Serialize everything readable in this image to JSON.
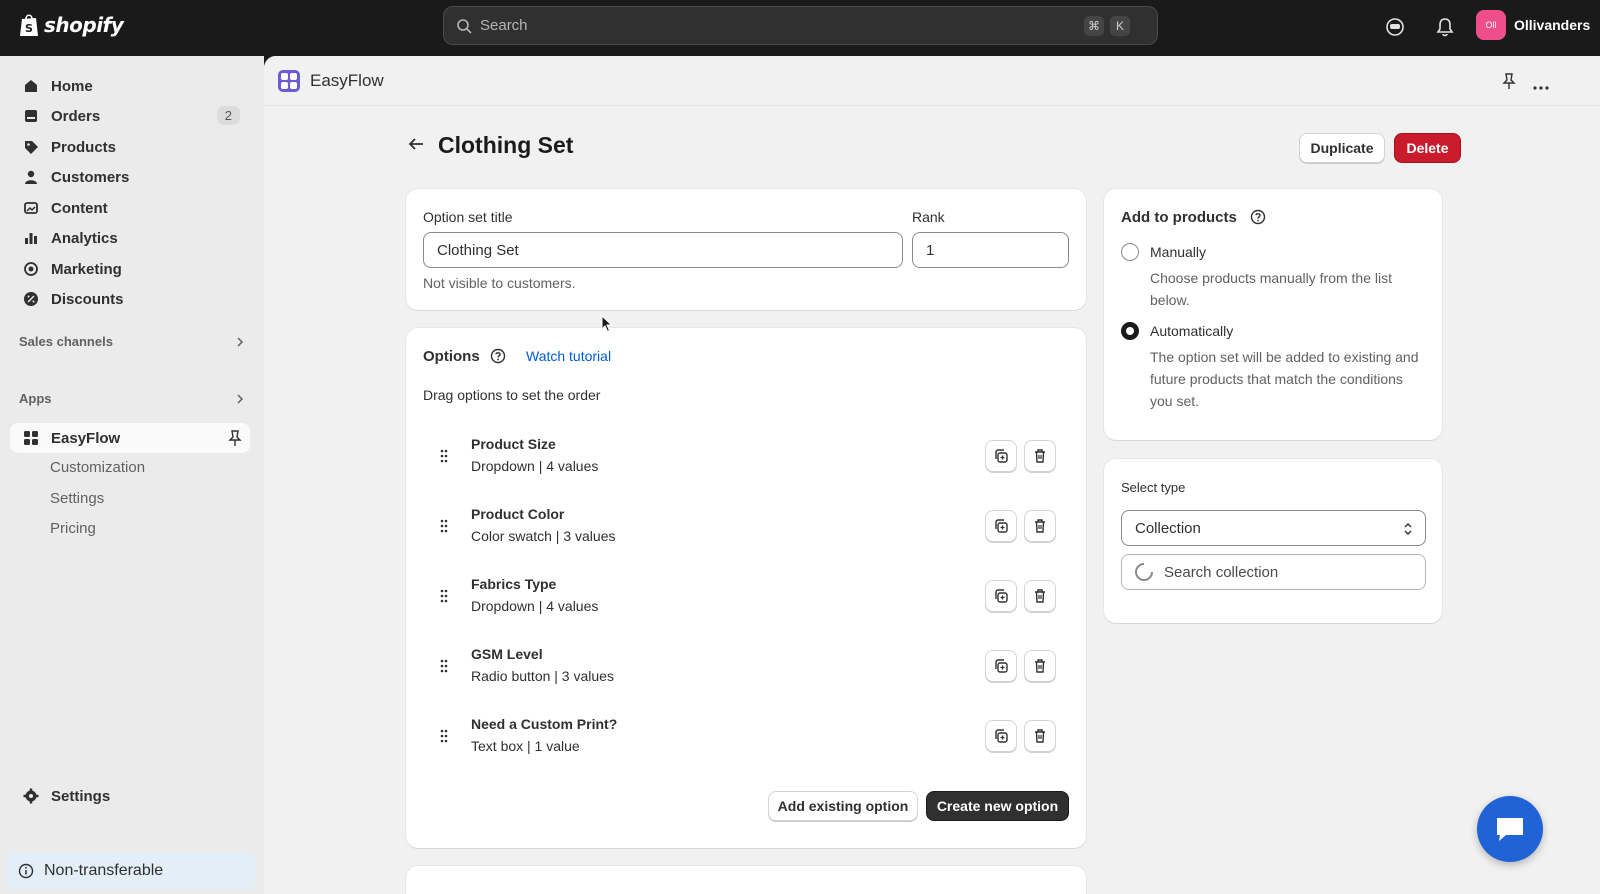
{
  "topbar": {
    "brand": "shopify",
    "search_placeholder": "Search",
    "shortcut_key1": "⌘",
    "shortcut_key2": "K",
    "store_initials": "Oll",
    "store_name": "Ollivanders"
  },
  "sidebar": {
    "items": [
      {
        "label": "Home",
        "icon": "home-icon"
      },
      {
        "label": "Orders",
        "icon": "orders-icon",
        "badge": "2"
      },
      {
        "label": "Products",
        "icon": "tag-icon"
      },
      {
        "label": "Customers",
        "icon": "person-icon"
      },
      {
        "label": "Content",
        "icon": "image-icon"
      },
      {
        "label": "Analytics",
        "icon": "bar-chart-icon"
      },
      {
        "label": "Marketing",
        "icon": "target-icon"
      },
      {
        "label": "Discounts",
        "icon": "discount-icon"
      }
    ],
    "sales_channels": "Sales channels",
    "apps": "Apps",
    "app_name": "EasyFlow",
    "app_sub": [
      "Customization",
      "Settings",
      "Pricing"
    ],
    "settings": "Settings",
    "non_transferable": "Non-transferable"
  },
  "app_header": {
    "title": "EasyFlow"
  },
  "page": {
    "title": "Clothing Set",
    "duplicate": "Duplicate",
    "delete": "Delete"
  },
  "title_card": {
    "title_label": "Option set title",
    "title_value": "Clothing Set",
    "rank_label": "Rank",
    "rank_value": "1",
    "hint": "Not visible to customers."
  },
  "options_card": {
    "heading": "Options",
    "tutorial_link": "Watch tutorial",
    "subtext": "Drag options to set the order",
    "options": [
      {
        "name": "Product Size",
        "meta": "Dropdown | 4 values"
      },
      {
        "name": "Product Color",
        "meta": "Color swatch | 3 values"
      },
      {
        "name": "Fabrics Type",
        "meta": "Dropdown | 4 values"
      },
      {
        "name": "GSM Level",
        "meta": "Radio button | 3 values"
      },
      {
        "name": "Need a Custom Print?",
        "meta": "Text box | 1 value"
      }
    ],
    "add_existing": "Add existing option",
    "create_new": "Create new option"
  },
  "add_products": {
    "heading": "Add to products",
    "manual_label": "Manually",
    "manual_desc": "Choose products manually from the list below.",
    "auto_label": "Automatically",
    "auto_desc": "The option set will be added to existing and future products that match the conditions you set.",
    "selected": "Automatically"
  },
  "select_type": {
    "label": "Select type",
    "value": "Collection",
    "search_placeholder": "Search collection"
  },
  "colors": {
    "accent_link": "#005bd3",
    "delete_red": "#c91b2b",
    "chat_blue": "#1f63d6",
    "store_avatar": "#ee4f8b"
  }
}
